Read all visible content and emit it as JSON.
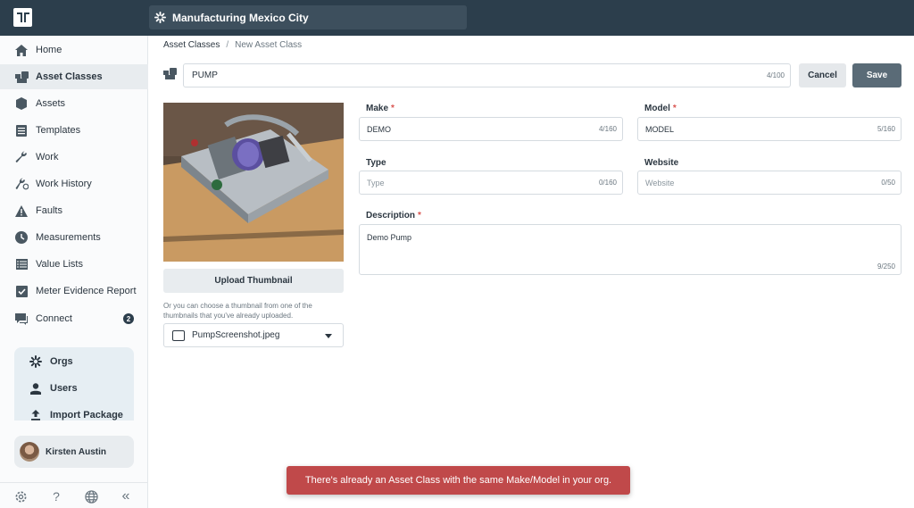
{
  "header": {
    "org_name": "Manufacturing Mexico City"
  },
  "sidebar": {
    "items": [
      {
        "label": "Home",
        "icon": "home-icon"
      },
      {
        "label": "Asset Classes",
        "icon": "asset-classes-icon",
        "active": true
      },
      {
        "label": "Assets",
        "icon": "assets-icon"
      },
      {
        "label": "Templates",
        "icon": "templates-icon"
      },
      {
        "label": "Work",
        "icon": "wrench-icon"
      },
      {
        "label": "Work History",
        "icon": "wrench-history-icon"
      },
      {
        "label": "Faults",
        "icon": "warning-icon"
      },
      {
        "label": "Measurements",
        "icon": "clock-icon"
      },
      {
        "label": "Value Lists",
        "icon": "list-icon"
      },
      {
        "label": "Meter Evidence Report",
        "icon": "checkbox-icon"
      },
      {
        "label": "Connect",
        "icon": "chat-icon",
        "badge": "2"
      }
    ],
    "admin": [
      {
        "label": "Orgs",
        "icon": "orgs-icon"
      },
      {
        "label": "Users",
        "icon": "user-icon"
      },
      {
        "label": "Import Package",
        "icon": "upload-icon"
      }
    ],
    "user_name": "Kirsten Austin",
    "footer": {
      "help": "?",
      "collapse": "«"
    }
  },
  "breadcrumb": {
    "parent": "Asset Classes",
    "separator": "/",
    "current": "New Asset Class"
  },
  "form": {
    "name_value": "PUMP",
    "name_counter": "4/100",
    "cancel_label": "Cancel",
    "save_label": "Save",
    "upload_label": "Upload Thumbnail",
    "hint": "Or you can choose a thumbnail from one of the thumbnails that you've already uploaded.",
    "thumbnail_selected": "PumpScreenshot.jpeg",
    "required_mark": "*",
    "make": {
      "label": "Make",
      "value": "DEMO",
      "counter": "4/160"
    },
    "model": {
      "label": "Model",
      "value": "MODEL",
      "counter": "5/160"
    },
    "type": {
      "label": "Type",
      "placeholder": "Type",
      "counter": "0/160"
    },
    "website": {
      "label": "Website",
      "placeholder": "Website",
      "counter": "0/50"
    },
    "description": {
      "label": "Description",
      "value": "Demo Pump",
      "counter": "9/250"
    }
  },
  "toast": {
    "message": "There's already an Asset Class with the same Make/Model in your org."
  },
  "colors": {
    "topbar": "#2c3e4c",
    "save_button": "#5a6b77",
    "toast": "#c0494a",
    "required": "#d9534f"
  }
}
